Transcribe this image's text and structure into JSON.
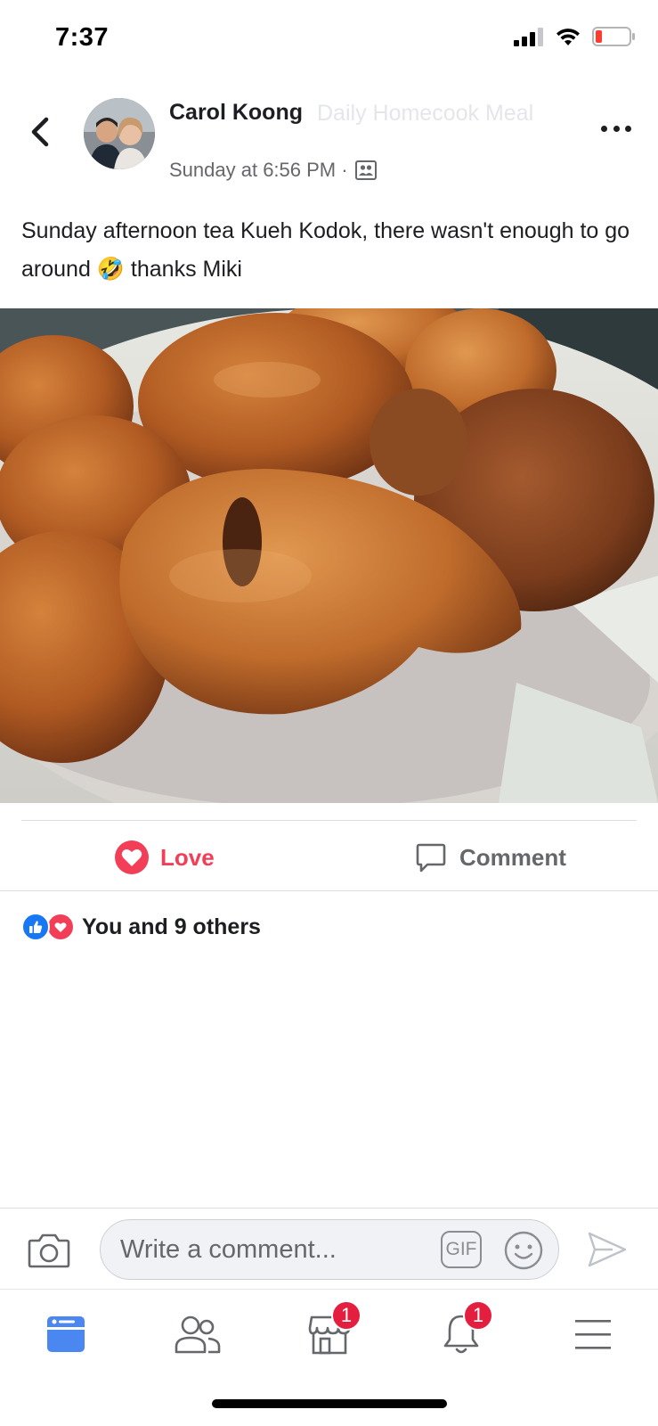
{
  "status_bar": {
    "time": "7:37",
    "icons": [
      "cellular-signal-icon",
      "wifi-icon",
      "battery-low-icon"
    ]
  },
  "post": {
    "author": "Carol Koong",
    "group": "Daily Homecook Meal",
    "timestamp": "Sunday at 6:56 PM ·",
    "privacy_icon": "group-icon",
    "text_part1": "Sunday afternoon tea Kueh Kodok, there wasn't enough to go around",
    "emoji": "🤣",
    "text_part2": "thanks Miki",
    "photo_icon": "photo-fried-fritters"
  },
  "actions": {
    "love_label": "Love",
    "comment_label": "Comment"
  },
  "reactions": {
    "summary": "You and 9 others",
    "types": [
      "like-icon",
      "love-icon"
    ]
  },
  "composer": {
    "placeholder": "Write a comment...",
    "gif_label": "GIF"
  },
  "tab_bar": {
    "tabs": [
      {
        "name": "news-feed",
        "badge": ""
      },
      {
        "name": "friends",
        "badge": ""
      },
      {
        "name": "marketplace",
        "badge": "1"
      },
      {
        "name": "notifications",
        "badge": "1"
      },
      {
        "name": "menu",
        "badge": ""
      }
    ]
  },
  "colors": {
    "accent": "#1877f2",
    "love": "#f33e58",
    "badge": "#e41e3f",
    "secondary_text": "#65676b"
  }
}
